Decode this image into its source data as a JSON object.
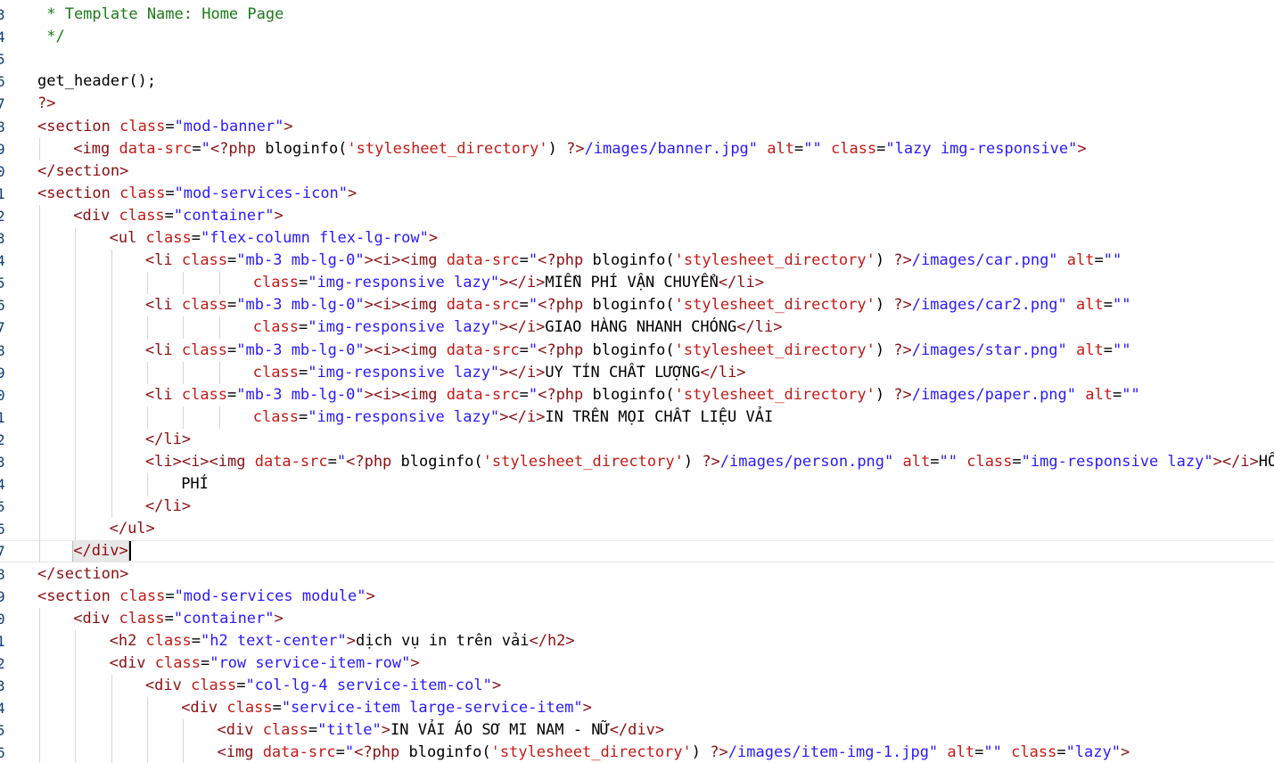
{
  "editor": {
    "lines": [
      {
        "num": "3",
        "indent": 0,
        "tokens": [
          [
            "comment",
            " * Template Name: Home Page"
          ]
        ]
      },
      {
        "num": "4",
        "indent": 0,
        "tokens": [
          [
            "comment",
            " */"
          ]
        ]
      },
      {
        "num": "5",
        "indent": 0,
        "tokens": []
      },
      {
        "num": "6",
        "indent": 0,
        "tokens": [
          [
            "plain",
            "get_header();"
          ]
        ]
      },
      {
        "num": "7",
        "indent": 0,
        "tokens": [
          [
            "php",
            "?>"
          ]
        ]
      },
      {
        "num": "8",
        "indent": 0,
        "tokens": [
          [
            "tag",
            "<section "
          ],
          [
            "attr",
            "class"
          ],
          [
            "plain",
            "="
          ],
          [
            "str",
            "\"mod-banner\""
          ],
          [
            "tag",
            ">"
          ]
        ]
      },
      {
        "num": "9",
        "indent": 1,
        "tokens": [
          [
            "tag",
            "<img "
          ],
          [
            "attr",
            "data-src"
          ],
          [
            "plain",
            "="
          ],
          [
            "str",
            "\""
          ],
          [
            "php",
            "<?php "
          ],
          [
            "plain",
            "bloginfo("
          ],
          [
            "phpstr",
            "'stylesheet_directory'"
          ],
          [
            "plain",
            ") "
          ],
          [
            "php",
            "?>"
          ],
          [
            "str",
            "/images/banner.jpg\""
          ],
          [
            "plain",
            " "
          ],
          [
            "attr",
            "alt"
          ],
          [
            "plain",
            "="
          ],
          [
            "str",
            "\"\""
          ],
          [
            "plain",
            " "
          ],
          [
            "attr",
            "class"
          ],
          [
            "plain",
            "="
          ],
          [
            "str",
            "\"lazy img-responsive\""
          ],
          [
            "tag",
            ">"
          ]
        ]
      },
      {
        "num": "0",
        "indent": 0,
        "tokens": [
          [
            "tag",
            "</section>"
          ]
        ]
      },
      {
        "num": "1",
        "indent": 0,
        "tokens": [
          [
            "tag",
            "<section "
          ],
          [
            "attr",
            "class"
          ],
          [
            "plain",
            "="
          ],
          [
            "str",
            "\"mod-services-icon\""
          ],
          [
            "tag",
            ">"
          ]
        ]
      },
      {
        "num": "2",
        "indent": 1,
        "tokens": [
          [
            "tag",
            "<div "
          ],
          [
            "attr",
            "class"
          ],
          [
            "plain",
            "="
          ],
          [
            "str",
            "\"container\""
          ],
          [
            "tag",
            ">"
          ]
        ]
      },
      {
        "num": "3",
        "indent": 2,
        "tokens": [
          [
            "tag",
            "<ul "
          ],
          [
            "attr",
            "class"
          ],
          [
            "plain",
            "="
          ],
          [
            "str",
            "\"flex-column flex-lg-row\""
          ],
          [
            "tag",
            ">"
          ]
        ]
      },
      {
        "num": "4",
        "indent": 3,
        "tokens": [
          [
            "tag",
            "<li "
          ],
          [
            "attr",
            "class"
          ],
          [
            "plain",
            "="
          ],
          [
            "str",
            "\"mb-3 mb-lg-0\""
          ],
          [
            "tag",
            "><i><img "
          ],
          [
            "attr",
            "data-src"
          ],
          [
            "plain",
            "="
          ],
          [
            "str",
            "\""
          ],
          [
            "php",
            "<?php "
          ],
          [
            "plain",
            "bloginfo("
          ],
          [
            "phpstr",
            "'stylesheet_directory'"
          ],
          [
            "plain",
            ") "
          ],
          [
            "php",
            "?>"
          ],
          [
            "str",
            "/images/car.png\""
          ],
          [
            "plain",
            " "
          ],
          [
            "attr",
            "alt"
          ],
          [
            "plain",
            "="
          ],
          [
            "str",
            "\"\""
          ]
        ]
      },
      {
        "num": "5",
        "indent": 6,
        "tokens": [
          [
            "attr",
            "class"
          ],
          [
            "plain",
            "="
          ],
          [
            "str",
            "\"img-responsive lazy\""
          ],
          [
            "tag",
            "></i>"
          ],
          [
            "plain",
            "MIỄN PHÍ VẬN CHUYỂN"
          ],
          [
            "tag",
            "</li>"
          ]
        ]
      },
      {
        "num": "6",
        "indent": 3,
        "tokens": [
          [
            "tag",
            "<li "
          ],
          [
            "attr",
            "class"
          ],
          [
            "plain",
            "="
          ],
          [
            "str",
            "\"mb-3 mb-lg-0\""
          ],
          [
            "tag",
            "><i><img "
          ],
          [
            "attr",
            "data-src"
          ],
          [
            "plain",
            "="
          ],
          [
            "str",
            "\""
          ],
          [
            "php",
            "<?php "
          ],
          [
            "plain",
            "bloginfo("
          ],
          [
            "phpstr",
            "'stylesheet_directory'"
          ],
          [
            "plain",
            ") "
          ],
          [
            "php",
            "?>"
          ],
          [
            "str",
            "/images/car2.png\""
          ],
          [
            "plain",
            " "
          ],
          [
            "attr",
            "alt"
          ],
          [
            "plain",
            "="
          ],
          [
            "str",
            "\"\""
          ]
        ]
      },
      {
        "num": "7",
        "indent": 6,
        "tokens": [
          [
            "attr",
            "class"
          ],
          [
            "plain",
            "="
          ],
          [
            "str",
            "\"img-responsive lazy\""
          ],
          [
            "tag",
            "></i>"
          ],
          [
            "plain",
            "GIAO HÀNG NHANH CHÓNG"
          ],
          [
            "tag",
            "</li>"
          ]
        ]
      },
      {
        "num": "8",
        "indent": 3,
        "tokens": [
          [
            "tag",
            "<li "
          ],
          [
            "attr",
            "class"
          ],
          [
            "plain",
            "="
          ],
          [
            "str",
            "\"mb-3 mb-lg-0\""
          ],
          [
            "tag",
            "><i><img "
          ],
          [
            "attr",
            "data-src"
          ],
          [
            "plain",
            "="
          ],
          [
            "str",
            "\""
          ],
          [
            "php",
            "<?php "
          ],
          [
            "plain",
            "bloginfo("
          ],
          [
            "phpstr",
            "'stylesheet_directory'"
          ],
          [
            "plain",
            ") "
          ],
          [
            "php",
            "?>"
          ],
          [
            "str",
            "/images/star.png\""
          ],
          [
            "plain",
            " "
          ],
          [
            "attr",
            "alt"
          ],
          [
            "plain",
            "="
          ],
          [
            "str",
            "\"\""
          ]
        ]
      },
      {
        "num": "9",
        "indent": 6,
        "tokens": [
          [
            "attr",
            "class"
          ],
          [
            "plain",
            "="
          ],
          [
            "str",
            "\"img-responsive lazy\""
          ],
          [
            "tag",
            "></i>"
          ],
          [
            "plain",
            "UY TÍN CHẤT LƯỢNG"
          ],
          [
            "tag",
            "</li>"
          ]
        ]
      },
      {
        "num": "0",
        "indent": 3,
        "tokens": [
          [
            "tag",
            "<li "
          ],
          [
            "attr",
            "class"
          ],
          [
            "plain",
            "="
          ],
          [
            "str",
            "\"mb-3 mb-lg-0\""
          ],
          [
            "tag",
            "><i><img "
          ],
          [
            "attr",
            "data-src"
          ],
          [
            "plain",
            "="
          ],
          [
            "str",
            "\""
          ],
          [
            "php",
            "<?php "
          ],
          [
            "plain",
            "bloginfo("
          ],
          [
            "phpstr",
            "'stylesheet_directory'"
          ],
          [
            "plain",
            ") "
          ],
          [
            "php",
            "?>"
          ],
          [
            "str",
            "/images/paper.png\""
          ],
          [
            "plain",
            " "
          ],
          [
            "attr",
            "alt"
          ],
          [
            "plain",
            "="
          ],
          [
            "str",
            "\"\""
          ]
        ]
      },
      {
        "num": "1",
        "indent": 6,
        "tokens": [
          [
            "attr",
            "class"
          ],
          [
            "plain",
            "="
          ],
          [
            "str",
            "\"img-responsive lazy\""
          ],
          [
            "tag",
            "></i>"
          ],
          [
            "plain",
            "IN TRÊN MỌI CHẤT LIỆU VẢI"
          ]
        ]
      },
      {
        "num": "2",
        "indent": 3,
        "tokens": [
          [
            "tag",
            "</li>"
          ]
        ]
      },
      {
        "num": "3",
        "indent": 3,
        "tokens": [
          [
            "tag",
            "<li><i><img "
          ],
          [
            "attr",
            "data-src"
          ],
          [
            "plain",
            "="
          ],
          [
            "str",
            "\""
          ],
          [
            "php",
            "<?php "
          ],
          [
            "plain",
            "bloginfo("
          ],
          [
            "phpstr",
            "'stylesheet_directory'"
          ],
          [
            "plain",
            ") "
          ],
          [
            "php",
            "?>"
          ],
          [
            "str",
            "/images/person.png\""
          ],
          [
            "plain",
            " "
          ],
          [
            "attr",
            "alt"
          ],
          [
            "plain",
            "="
          ],
          [
            "str",
            "\"\""
          ],
          [
            "plain",
            " "
          ],
          [
            "attr",
            "class"
          ],
          [
            "plain",
            "="
          ],
          [
            "str",
            "\"img-responsive lazy\""
          ],
          [
            "tag",
            "></i>"
          ],
          [
            "plain",
            "HỖ T"
          ]
        ]
      },
      {
        "num": "4",
        "indent": 4,
        "tokens": [
          [
            "plain",
            "PHÍ"
          ]
        ]
      },
      {
        "num": "5",
        "indent": 3,
        "tokens": [
          [
            "tag",
            "</li>"
          ]
        ]
      },
      {
        "num": "6",
        "indent": 2,
        "tokens": [
          [
            "tag",
            "</ul>"
          ]
        ]
      },
      {
        "num": "7",
        "indent": 1,
        "tokens": [
          [
            "tag",
            "</div>"
          ]
        ],
        "current": true
      },
      {
        "num": "8",
        "indent": 0,
        "tokens": [
          [
            "tag",
            "</section>"
          ]
        ]
      },
      {
        "num": "9",
        "indent": 0,
        "tokens": [
          [
            "tag",
            "<section "
          ],
          [
            "attr",
            "class"
          ],
          [
            "plain",
            "="
          ],
          [
            "str",
            "\"mod-services module\""
          ],
          [
            "tag",
            ">"
          ]
        ]
      },
      {
        "num": "0",
        "indent": 1,
        "tokens": [
          [
            "tag",
            "<div "
          ],
          [
            "attr",
            "class"
          ],
          [
            "plain",
            "="
          ],
          [
            "str",
            "\"container\""
          ],
          [
            "tag",
            ">"
          ]
        ]
      },
      {
        "num": "1",
        "indent": 2,
        "tokens": [
          [
            "tag",
            "<h2 "
          ],
          [
            "attr",
            "class"
          ],
          [
            "plain",
            "="
          ],
          [
            "str",
            "\"h2 text-center\""
          ],
          [
            "tag",
            ">"
          ],
          [
            "plain",
            "dịch vụ in trên vải"
          ],
          [
            "tag",
            "</h2>"
          ]
        ]
      },
      {
        "num": "2",
        "indent": 2,
        "tokens": [
          [
            "tag",
            "<div "
          ],
          [
            "attr",
            "class"
          ],
          [
            "plain",
            "="
          ],
          [
            "str",
            "\"row service-item-row\""
          ],
          [
            "tag",
            ">"
          ]
        ]
      },
      {
        "num": "3",
        "indent": 3,
        "tokens": [
          [
            "tag",
            "<div "
          ],
          [
            "attr",
            "class"
          ],
          [
            "plain",
            "="
          ],
          [
            "str",
            "\"col-lg-4 service-item-col\""
          ],
          [
            "tag",
            ">"
          ]
        ]
      },
      {
        "num": "4",
        "indent": 4,
        "tokens": [
          [
            "tag",
            "<div "
          ],
          [
            "attr",
            "class"
          ],
          [
            "plain",
            "="
          ],
          [
            "str",
            "\"service-item large-service-item\""
          ],
          [
            "tag",
            ">"
          ]
        ]
      },
      {
        "num": "5",
        "indent": 5,
        "tokens": [
          [
            "tag",
            "<div "
          ],
          [
            "attr",
            "class"
          ],
          [
            "plain",
            "="
          ],
          [
            "str",
            "\"title\""
          ],
          [
            "tag",
            ">"
          ],
          [
            "plain",
            "IN VẢI ÁO SƠ MI NAM - NỮ"
          ],
          [
            "tag",
            "</div>"
          ]
        ]
      },
      {
        "num": "6",
        "indent": 5,
        "tokens": [
          [
            "tag",
            "<img "
          ],
          [
            "attr",
            "data-src"
          ],
          [
            "plain",
            "="
          ],
          [
            "str",
            "\""
          ],
          [
            "php",
            "<?php "
          ],
          [
            "plain",
            "bloginfo("
          ],
          [
            "phpstr",
            "'stylesheet_directory'"
          ],
          [
            "plain",
            ") "
          ],
          [
            "php",
            "?>"
          ],
          [
            "str",
            "/images/item-img-1.jpg\""
          ],
          [
            "plain",
            " "
          ],
          [
            "attr",
            "alt"
          ],
          [
            "plain",
            "="
          ],
          [
            "str",
            "\"\""
          ],
          [
            "plain",
            " "
          ],
          [
            "attr",
            "class"
          ],
          [
            "plain",
            "="
          ],
          [
            "str",
            "\"lazy\""
          ],
          [
            "tag",
            ">"
          ]
        ]
      }
    ],
    "colors": {
      "comment": "#1c7a18",
      "tag": "#8b0f12",
      "attribute": "#c41a16",
      "string": "#2a1aff",
      "plain": "#000000",
      "line_number": "#0c3c78"
    }
  }
}
